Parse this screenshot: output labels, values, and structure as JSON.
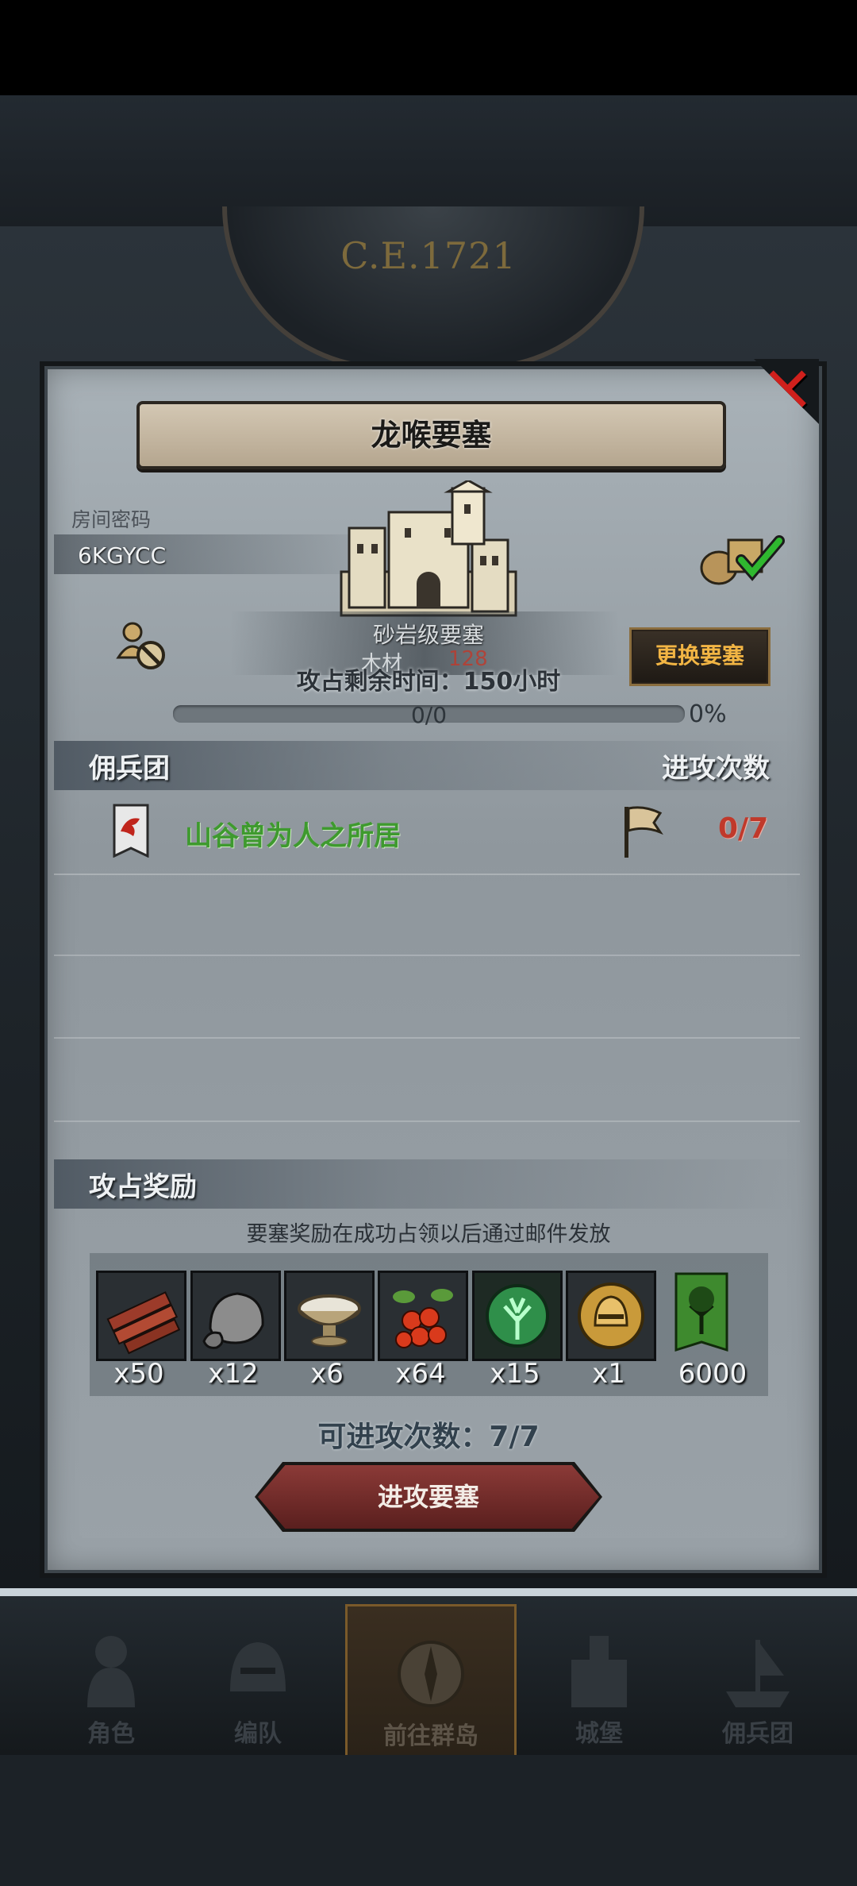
{
  "era": "C.E.1721",
  "fortress": {
    "title": "龙喉要塞",
    "room_label": "房间密码",
    "room_code": "6KGYCC",
    "type_text": "砂岩级要塞",
    "wood_label": "木材",
    "wood_value": "128",
    "time_left": "攻占剩余时间：150小时",
    "change_button": "更换要塞",
    "progress_text": "0/0",
    "progress_percent": "0%",
    "progress_fraction": 0
  },
  "mercenary": {
    "header_left": "佣兵团",
    "header_right": "进攻次数",
    "rows": [
      {
        "name": "山谷曾为人之所居",
        "count": "0/7"
      }
    ]
  },
  "rewards": {
    "header": "攻占奖励",
    "note": "要塞奖励在成功占领以后通过邮件发放",
    "items": [
      {
        "icon": "wood-logs-icon",
        "qty": "x50"
      },
      {
        "icon": "stone-ore-icon",
        "qty": "x12"
      },
      {
        "icon": "salt-bowl-icon",
        "qty": "x6"
      },
      {
        "icon": "berries-icon",
        "qty": "x64"
      },
      {
        "icon": "green-tree-rune-icon",
        "qty": "x15"
      },
      {
        "icon": "gold-helmet-coin-icon",
        "qty": "x1"
      },
      {
        "icon": "tree-banner-icon",
        "qty": "6000"
      }
    ]
  },
  "attack": {
    "remaining": "可进攻次数：7/7",
    "button": "进攻要塞"
  },
  "nav": {
    "items": [
      {
        "label": "角色",
        "icon": "knight-icon"
      },
      {
        "label": "编队",
        "icon": "helmet-icon"
      },
      {
        "label": "前往群岛",
        "icon": "compass-icon"
      },
      {
        "label": "城堡",
        "icon": "castle-icon"
      },
      {
        "label": "佣兵团",
        "icon": "ship-icon"
      }
    ]
  },
  "colors": {
    "accent_gold": "#f2b544",
    "merc_green": "#3e9a2e",
    "count_red": "#c0392b",
    "close_red": "#d0201c"
  }
}
